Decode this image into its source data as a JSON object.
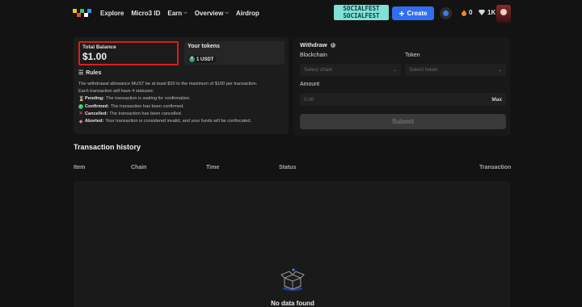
{
  "nav": {
    "items": [
      {
        "label": "Explore"
      },
      {
        "label": "Micro3 ID"
      },
      {
        "label": "Earn",
        "has_dropdown": true
      },
      {
        "label": "Overview",
        "has_dropdown": true
      },
      {
        "label": "Airdrop"
      }
    ]
  },
  "header": {
    "banner_lines": [
      "SOCIALFEST",
      "SOCIALFEST"
    ],
    "create_label": "Create",
    "fire_count": "0",
    "gem_count": "1K",
    "accent_color": "#2f6ff0"
  },
  "balance": {
    "label": "Total Balance",
    "value": "$1.00",
    "highlight_color": "#d61f1f"
  },
  "tokens": {
    "label": "Your tokens",
    "chip": "1 USDT",
    "chip_icon_letter": "T"
  },
  "rules": {
    "title": "Rules",
    "line1": "The withdrawal allowance MUST be at least $20 to the maximum of $100 per transaction.",
    "line2": "Each transaction will have 4 statuses:",
    "statuses": [
      {
        "icon": "hourglass-icon",
        "name": "Pending:",
        "desc": "The transaction is waiting for confirmation."
      },
      {
        "icon": "check-circle-icon",
        "name": "Confirmed:",
        "desc": "The transaction has been confirmed."
      },
      {
        "icon": "cross-icon",
        "name": "Cancelled:",
        "desc": "The transaction has been cancelled."
      },
      {
        "icon": "diamond-icon",
        "name": "Aborted:",
        "desc": "Your transaction is considered invalid, and your funds will be confiscated."
      }
    ]
  },
  "withdraw": {
    "title": "Withdraw",
    "blockchain_label": "Blockchain",
    "blockchain_placeholder": "Select chain",
    "token_label": "Token",
    "token_placeholder": "Select token",
    "amount_label": "Amount",
    "amount_placeholder": "0.00",
    "max_label": "Max",
    "submit_label": "Submit"
  },
  "history": {
    "title": "Transaction history",
    "columns": [
      "Item",
      "Chain",
      "Time",
      "Status",
      "Transaction"
    ],
    "empty_text": "No data found"
  }
}
